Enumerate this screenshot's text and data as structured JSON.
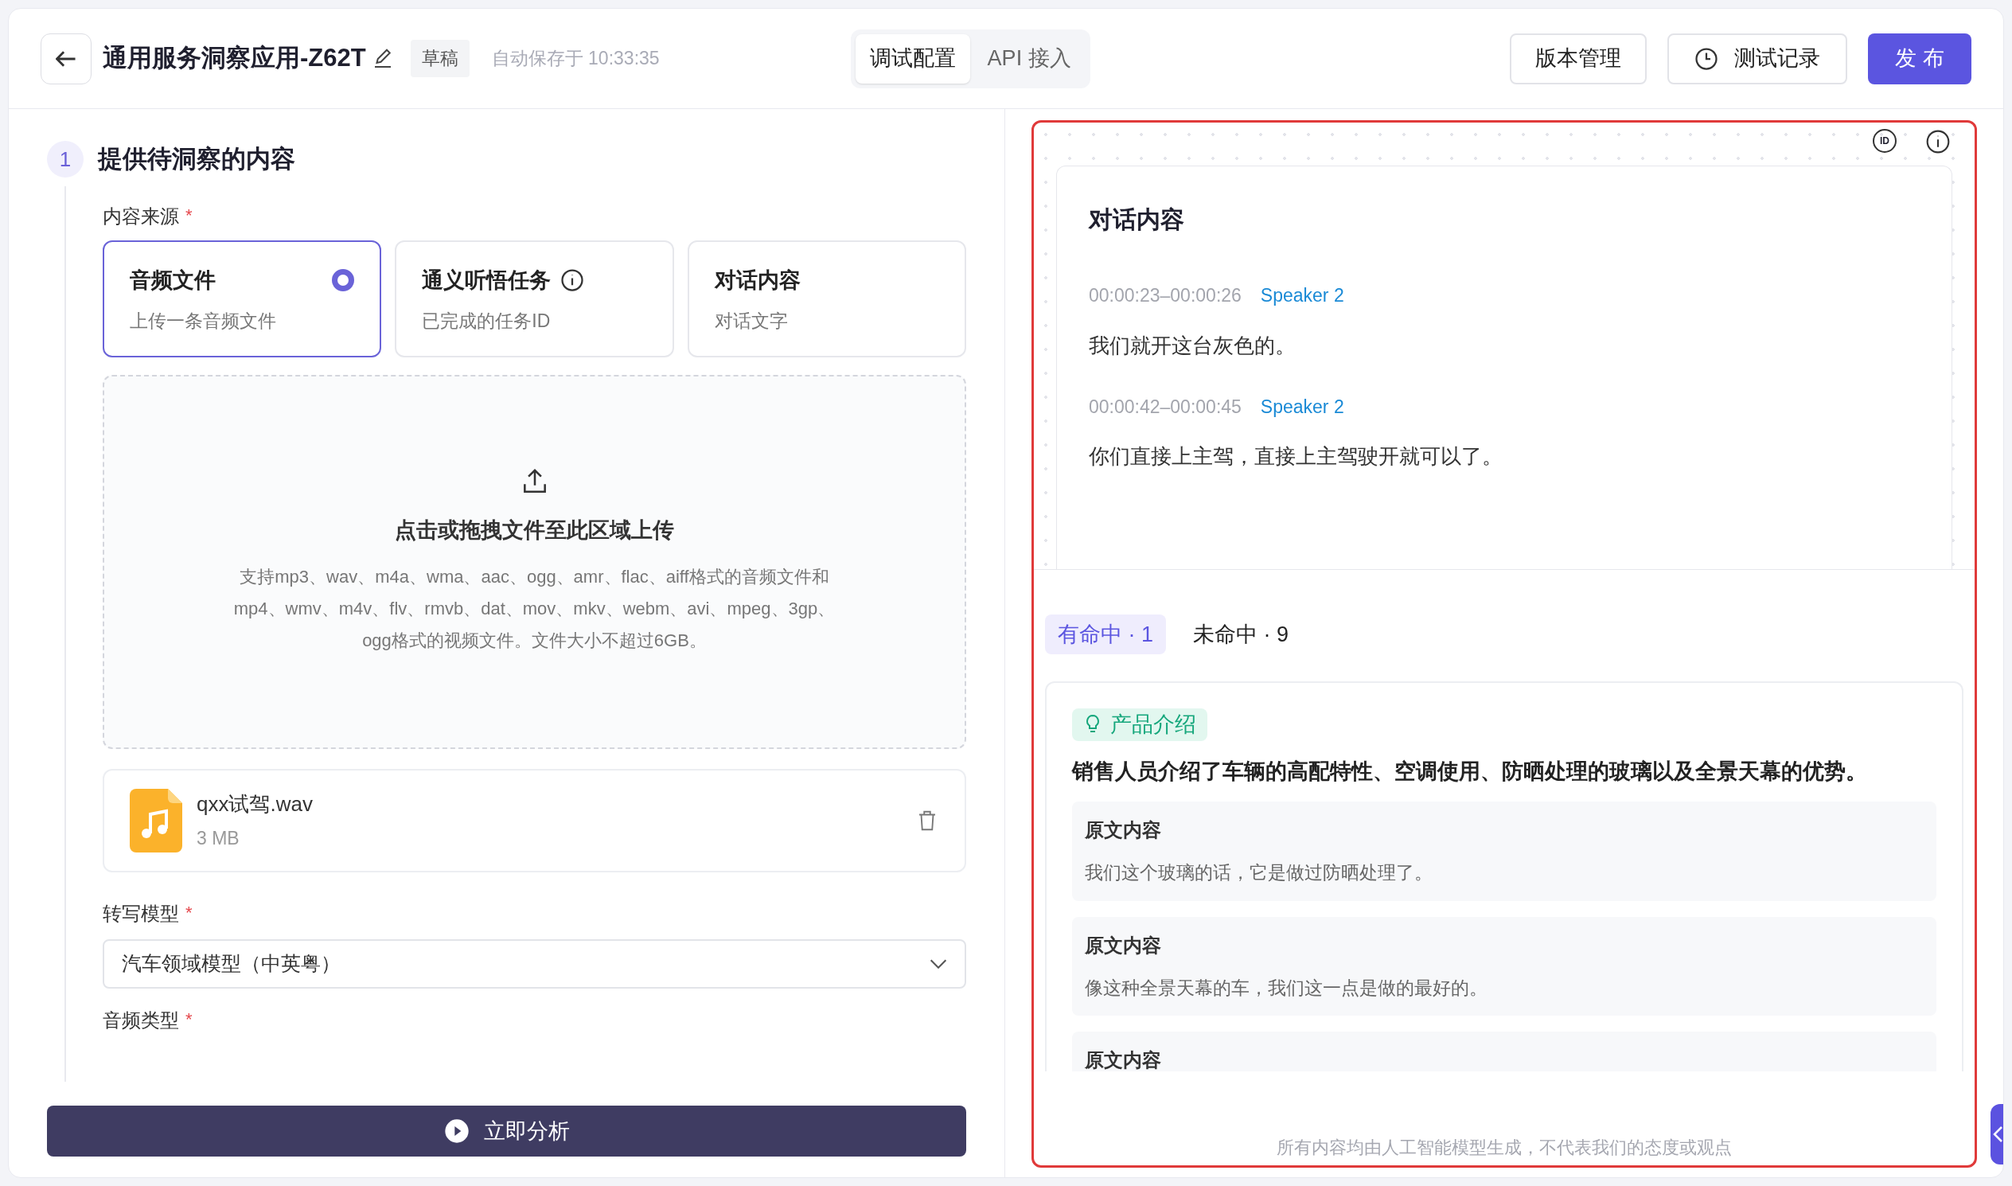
{
  "header": {
    "title": "通用服务洞察应用-Z62T",
    "status_tag": "草稿",
    "autosave": "自动保存于 10:33:35"
  },
  "mode_tabs": [
    {
      "label": "调试配置",
      "selected": true
    },
    {
      "label": "API 接入",
      "selected": false
    }
  ],
  "actions": [
    {
      "label": "版本管理",
      "kind": "plain"
    },
    {
      "label": "测试记录",
      "kind": "history"
    },
    {
      "label": "发 布",
      "kind": "primary"
    }
  ],
  "step": {
    "number": "1",
    "title": "提供待洞察的内容"
  },
  "source": {
    "label": "内容来源",
    "required_mark": "*",
    "options": [
      {
        "title": "音频文件",
        "subtitle": "上传一条音频文件",
        "selected": true,
        "info": false
      },
      {
        "title": "通义听悟任务",
        "subtitle": "已完成的任务ID",
        "selected": false,
        "info": true
      },
      {
        "title": "对话内容",
        "subtitle": "对话文字",
        "selected": false,
        "info": false
      }
    ]
  },
  "upload": {
    "title": "点击或拖拽文件至此区域上传",
    "hint": "支持mp3、wav、m4a、wma、aac、ogg、amr、flac、aiff格式的音频文件和mp4、wmv、m4v、flv、rmvb、dat、mov、mkv、webm、avi、mpeg、3gp、ogg格式的视频文件。文件大小不超过6GB。"
  },
  "file": {
    "name": "qxx试驾.wav",
    "size": "3 MB"
  },
  "model_field": {
    "label": "转写模型",
    "required_mark": "*",
    "value": "汽车领域模型（中英粤）"
  },
  "audio_type_field": {
    "label": "音频类型",
    "required_mark": "*"
  },
  "analyze_button": "立即分析",
  "preview": {
    "id_badge": "ID",
    "dialogue": {
      "title": "对话内容",
      "entries": [
        {
          "time": "00:00:23–00:00:26",
          "speaker": "Speaker 2",
          "text": "我们就开这台灰色的。"
        },
        {
          "time": "00:00:42–00:00:45",
          "speaker": "Speaker 2",
          "text": "你们直接上主驾，直接上主驾驶开就可以了。"
        }
      ]
    },
    "hit_tabs": [
      {
        "label": "有命中 · 1",
        "selected": true
      },
      {
        "label": "未命中 · 9",
        "selected": false
      }
    ],
    "hits": [
      {
        "tag": "产品介绍",
        "summary": "销售人员介绍了车辆的高配特性、空调使用、防晒处理的玻璃以及全景天幕的优势。",
        "quotes": [
          {
            "label": "原文内容",
            "text": "我们这个玻璃的话，它是做过防晒处理了。"
          },
          {
            "label": "原文内容",
            "text": "像这种全景天幕的车，我们这一点是做的最好的。"
          },
          {
            "label": "原文内容"
          }
        ]
      }
    ],
    "footer": "所有内容均由人工智能模型生成，不代表我们的态度或观点"
  }
}
